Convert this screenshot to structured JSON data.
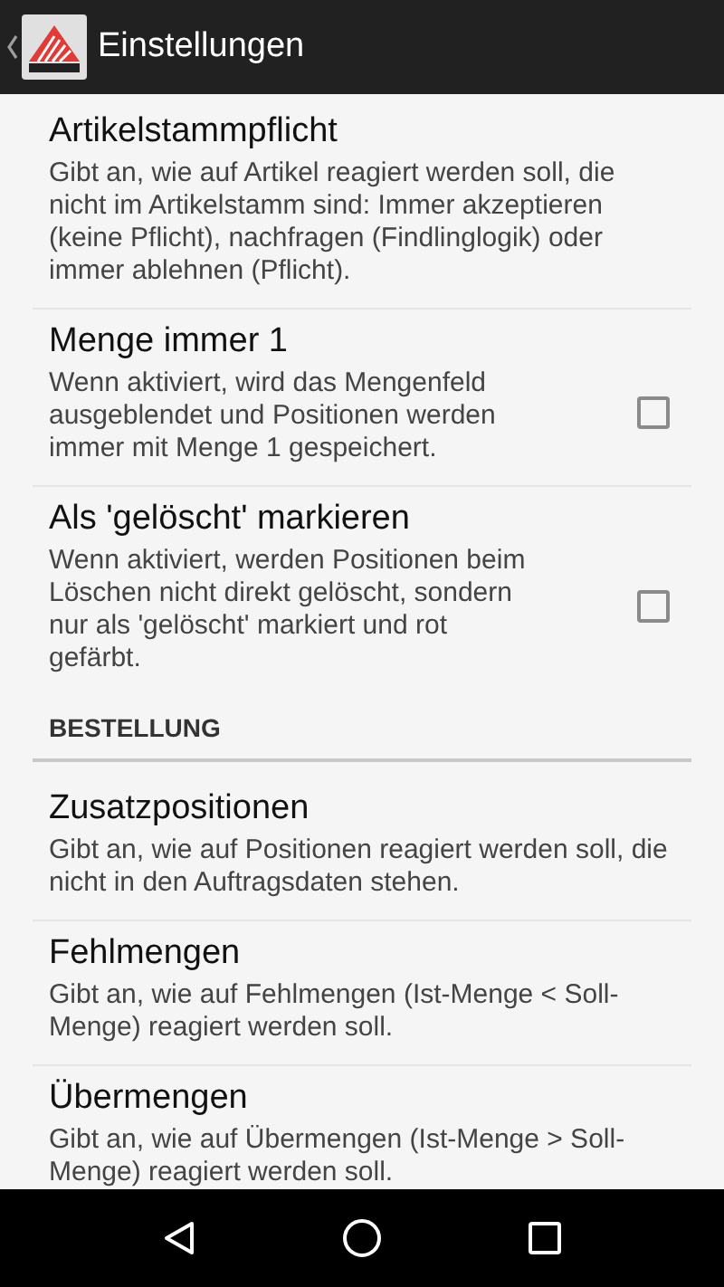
{
  "action_bar": {
    "title": "Einstellungen"
  },
  "items": [
    {
      "kind": "text",
      "title": "Artikelstammpflicht",
      "summary": "Gibt an, wie auf Artikel reagiert werden soll, die nicht im Artikelstamm sind: Immer akzeptieren (keine Pflicht), nachfragen (Findlinglogik) oder immer ablehnen (Pflicht)."
    },
    {
      "kind": "checkbox",
      "title": "Menge immer 1",
      "summary": "Wenn aktiviert, wird das Mengenfeld ausgeblendet und Positionen werden immer mit Menge 1 gespeichert.",
      "checked": false
    },
    {
      "kind": "checkbox",
      "title": "Als 'gelöscht' markieren",
      "summary": "Wenn aktiviert, werden Positionen beim Löschen nicht direkt gelöscht, sondern nur als 'gelöscht' markiert und rot gefärbt.",
      "checked": false
    },
    {
      "kind": "category",
      "title": "BESTELLUNG"
    },
    {
      "kind": "text",
      "title": "Zusatzpositionen",
      "summary": "Gibt an, wie auf Positionen reagiert werden soll, die nicht in den Auftragsdaten stehen."
    },
    {
      "kind": "text",
      "title": "Fehlmengen",
      "summary": "Gibt an, wie auf Fehlmengen (Ist-Menge < Soll-Menge) reagiert werden soll."
    },
    {
      "kind": "text",
      "title": "Übermengen",
      "summary": "Gibt an, wie auf Übermengen (Ist-Menge > Soll-Menge) reagiert werden soll."
    }
  ]
}
